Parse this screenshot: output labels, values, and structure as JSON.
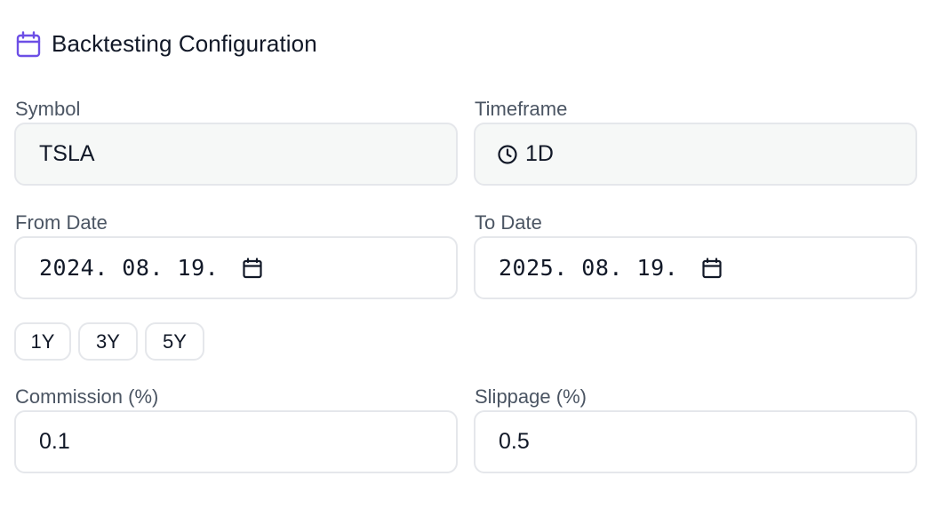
{
  "header": {
    "title": "Backtesting Configuration",
    "icon": "calendar-icon",
    "accent": "#6d4fe6"
  },
  "symbol": {
    "label": "Symbol",
    "value": "TSLA"
  },
  "timeframe": {
    "label": "Timeframe",
    "value": "1D",
    "icon": "clock-icon"
  },
  "from_date": {
    "label": "From Date",
    "value": "2024. 08. 19."
  },
  "to_date": {
    "label": "To Date",
    "value": "2025. 08. 19."
  },
  "presets": [
    "1Y",
    "3Y",
    "5Y"
  ],
  "commission": {
    "label": "Commission (%)",
    "value": "0.1"
  },
  "slippage": {
    "label": "Slippage (%)",
    "value": "0.5"
  }
}
